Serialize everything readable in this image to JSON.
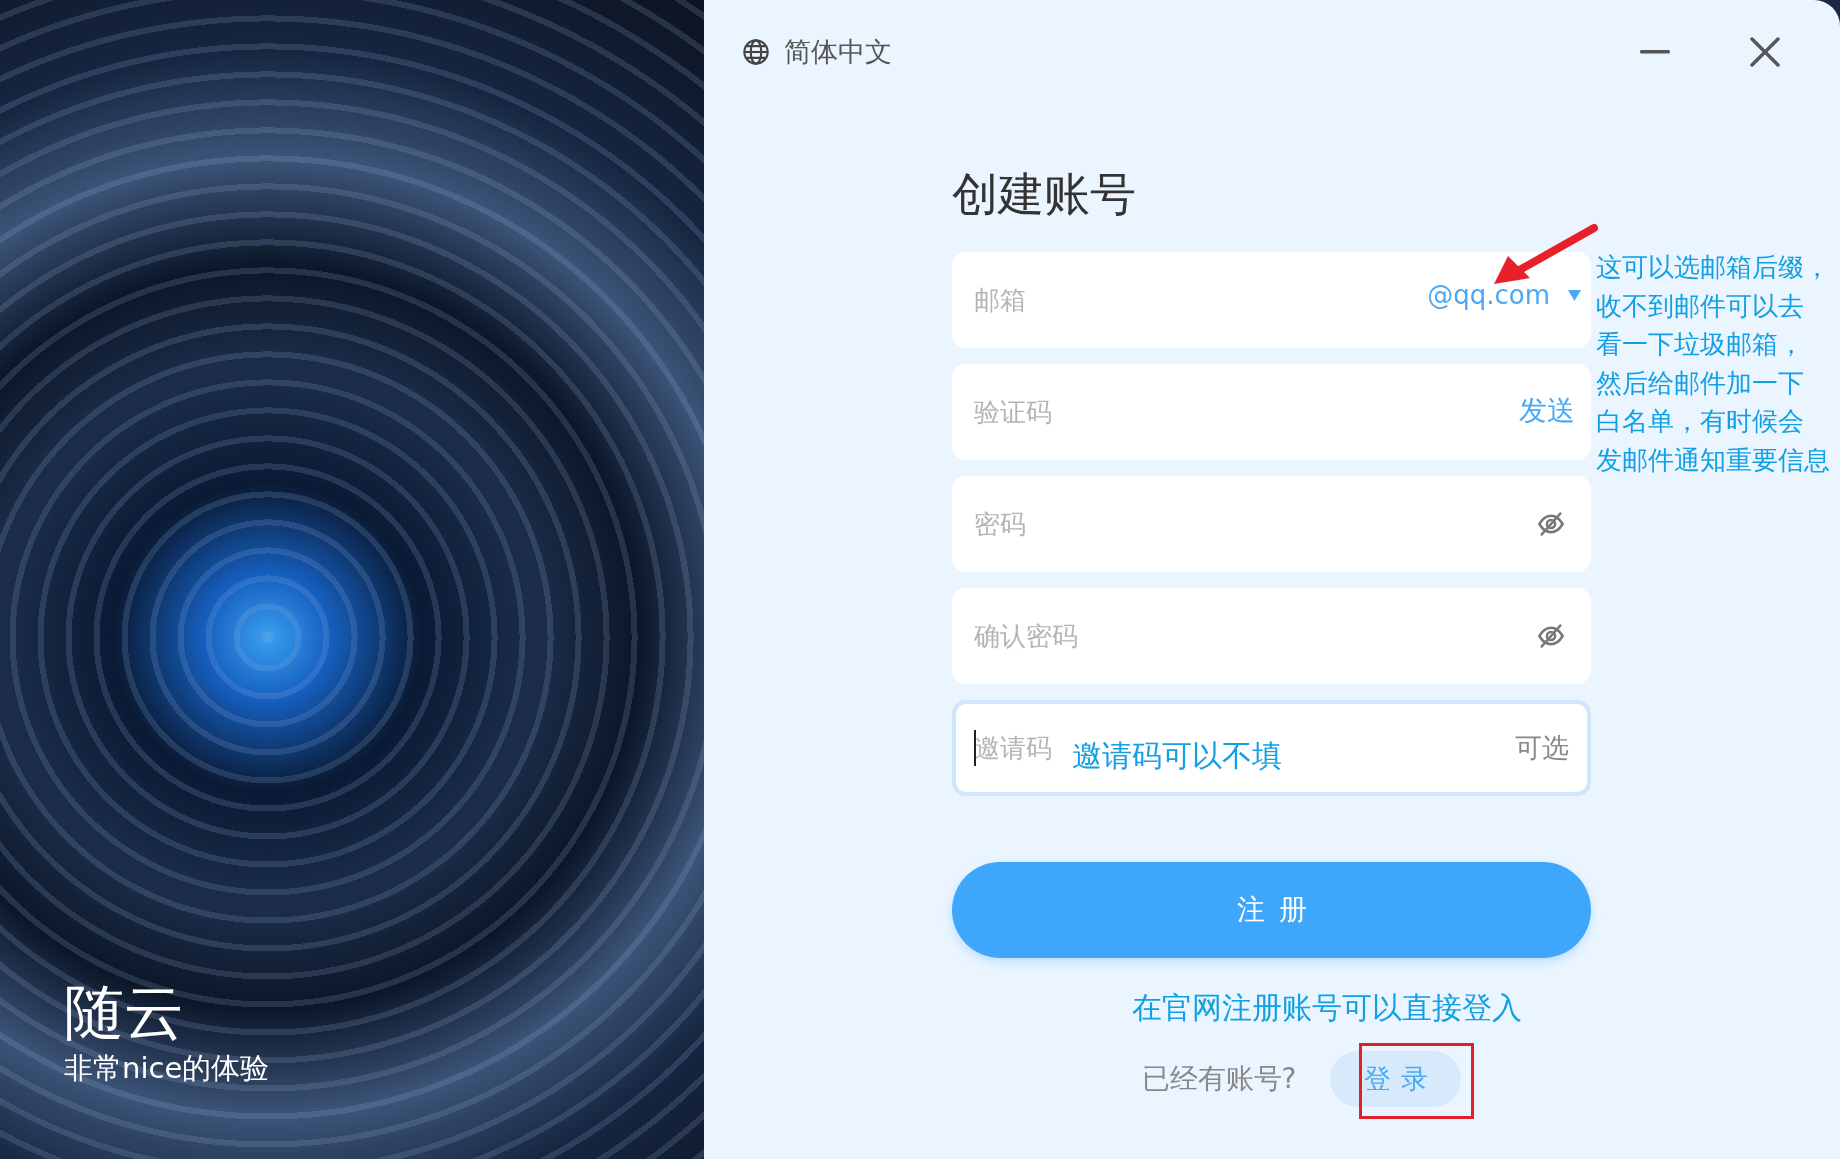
{
  "brand": {
    "name": "随云",
    "tagline": "非常nice的体验"
  },
  "header": {
    "language": "简体中文"
  },
  "form": {
    "title": "创建账号",
    "fields": [
      {
        "kind": "email",
        "placeholder": "邮箱",
        "suffix": "@qq.com",
        "focused": false
      },
      {
        "kind": "code",
        "placeholder": "验证码",
        "action": "发送",
        "focused": false
      },
      {
        "kind": "password",
        "placeholder": "密码",
        "focused": false
      },
      {
        "kind": "password",
        "placeholder": "确认密码",
        "focused": false
      },
      {
        "kind": "optional",
        "placeholder": "邀请码",
        "hint": "可选",
        "note": "邀请码可以不填",
        "focused": true
      }
    ],
    "submit": "注册",
    "site_note": "在官网注册账号可以直接登入",
    "login_prompt": "已经有账号?",
    "login": "登录"
  },
  "annotation": {
    "lines": [
      "这可以选邮箱后缀，",
      "收不到邮件可以去",
      "看一下垃圾邮箱，",
      "然后给邮件加一下",
      "白名单，有时候会",
      "发邮件通知重要信息"
    ]
  }
}
